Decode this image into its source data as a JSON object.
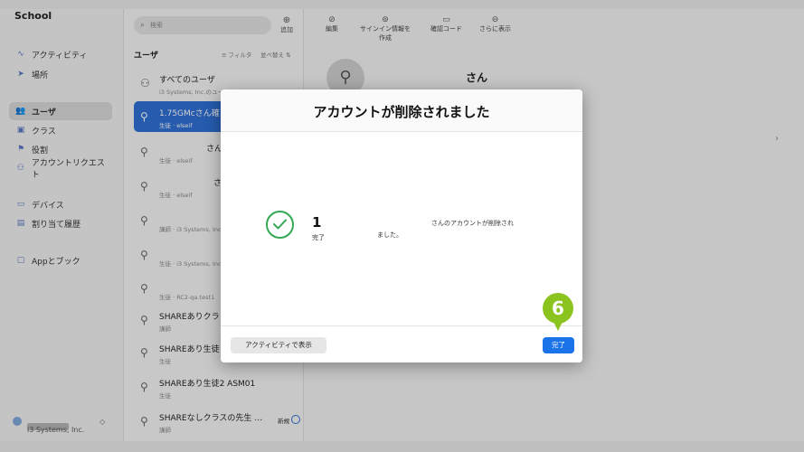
{
  "sidebar": {
    "logo": " School",
    "items": [
      {
        "icon": "activity-icon",
        "glyph": "∿",
        "label": "アクティビティ"
      },
      {
        "icon": "location-icon",
        "glyph": "➤",
        "label": "場所"
      },
      {
        "icon": "users-icon",
        "glyph": "👥",
        "label": "ユーザ"
      },
      {
        "icon": "class-icon",
        "glyph": "▣",
        "label": "クラス"
      },
      {
        "icon": "role-icon",
        "glyph": "⚑",
        "label": "役割"
      },
      {
        "icon": "account-request-icon",
        "glyph": "⚇",
        "label": "アカウントリクエスト"
      },
      {
        "icon": "device-icon",
        "glyph": "▭",
        "label": "デバイス"
      },
      {
        "icon": "assignment-icon",
        "glyph": "▤",
        "label": "割り当て履歴"
      },
      {
        "icon": "apps-icon",
        "glyph": "▢",
        "label": "Appとブック"
      }
    ],
    "org": "i3 Systems, Inc."
  },
  "list": {
    "search_placeholder": "検索",
    "add_label": "追加",
    "title": "ユーザ",
    "filter_label": "フィルタ",
    "sort_label": "並べ替え",
    "rows": [
      {
        "name": "すべてのユーザ",
        "sub": "i3 Systems, Inc.のユーザ",
        "icon": "group-icon"
      },
      {
        "name": "1.75GMcさん確",
        "sub": "生徒 · elseif",
        "icon": "user-icon"
      },
      {
        "name": "さん",
        "sub": "生徒 · elseif",
        "icon": "user-icon"
      },
      {
        "name": "さ",
        "sub": "生徒 · elseif",
        "icon": "user-icon"
      },
      {
        "name": "",
        "sub": "講師 · i3 Systems, Inc",
        "icon": "user-icon"
      },
      {
        "name": "",
        "sub": "生徒 · i3 Systems, Inc",
        "icon": "user-icon"
      },
      {
        "name": "",
        "sub": "生徒 · RC2-qa.test1",
        "icon": "user-icon"
      },
      {
        "name": "SHAREありクラ",
        "sub": "講師",
        "icon": "user-icon"
      },
      {
        "name": "SHAREあり生徒",
        "sub": "生徒",
        "icon": "user-icon"
      },
      {
        "name": "SHAREあり生徒2 ASM01",
        "sub": "生徒",
        "icon": "user-icon"
      },
      {
        "name": "SHAREなしクラスの先生 …",
        "sub": "講師",
        "icon": "user-icon",
        "badge": "新規"
      }
    ]
  },
  "toolbar": {
    "edit": "編集",
    "signin": "サインイン情報を作成",
    "confirm": "確認コード",
    "more": "さらに表示"
  },
  "profile": {
    "name": "さん"
  },
  "modal": {
    "title": "アカウントが削除されました",
    "count": "1",
    "count_label": "完了",
    "message_line1": "さんのアカウントが削除され",
    "message_line2": "ました。",
    "activity_button": "アクティビティで表示",
    "done_button": "完了"
  },
  "marker": {
    "number": "6"
  },
  "colors": {
    "accent": "#1a73e8",
    "success": "#34a853",
    "marker": "#8bc31f"
  }
}
